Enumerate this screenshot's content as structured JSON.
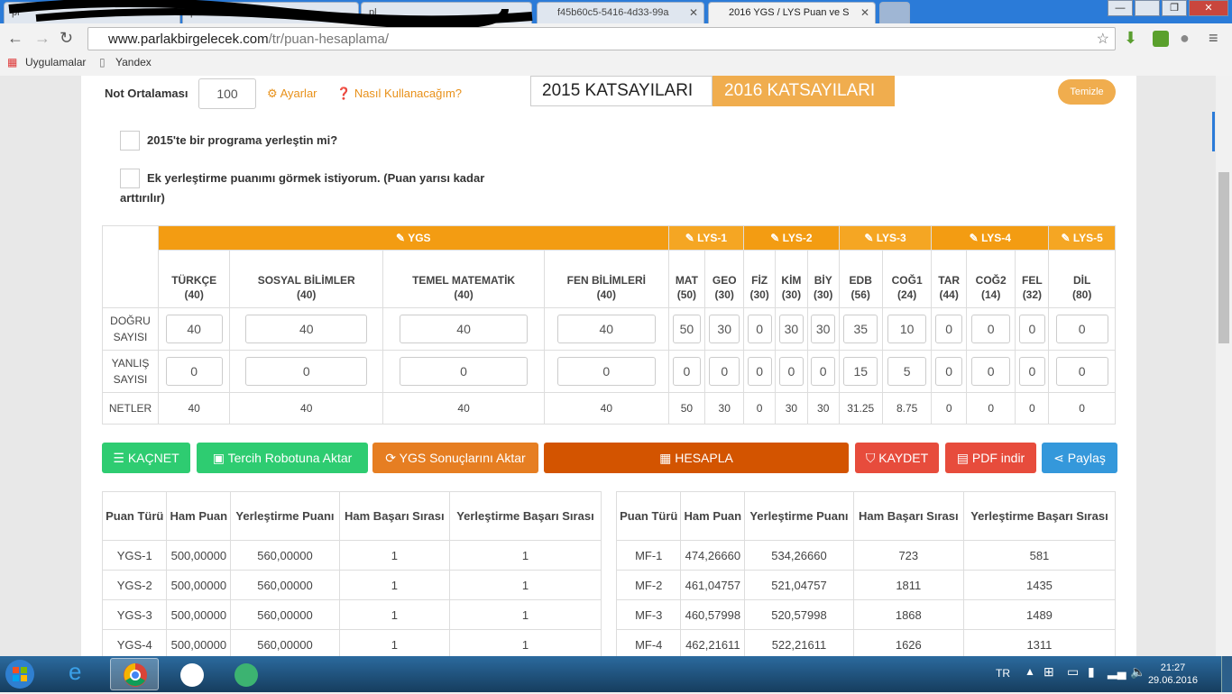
{
  "browser": {
    "tabs": [
      {
        "label": "pl"
      },
      {
        "label": "pl"
      },
      {
        "label": "f45b60c5-5416-4d33-99a"
      },
      {
        "label": "2016 YGS / LYS Puan ve S"
      }
    ],
    "url_domain": "www.parlakbirgelecek.com",
    "url_path": "/tr/puan-hesaplama/",
    "bookmarks": [
      "Uygulamalar",
      "Yandex"
    ]
  },
  "form": {
    "not_ortalamasi_label": "Not Ortalaması",
    "not_ortalamasi_value": "100",
    "ayarlar": "Ayarlar",
    "nasil": "Nasıl Kullanacağım?",
    "coef_2015": "2015 KATSAYILARI",
    "coef_2016": "2016 KATSAYILARI",
    "temizle": "Temizle",
    "check1": "2015'te bir programa yerleştin mi?",
    "check2_line1": "Ek yerleştirme puanımı görmek istiyorum. (Puan yarısı kadar",
    "check2_line2": "arttırılır)"
  },
  "score_table": {
    "groups": [
      "YGS",
      "LYS-1",
      "LYS-2",
      "LYS-3",
      "LYS-4",
      "LYS-5"
    ],
    "subjects": [
      [
        "TÜRKÇE",
        "(40)"
      ],
      [
        "SOSYAL BİLİMLER",
        "(40)"
      ],
      [
        "TEMEL MATEMATİK",
        "(40)"
      ],
      [
        "FEN BİLİMLERİ",
        "(40)"
      ],
      [
        "MAT",
        "(50)"
      ],
      [
        "GEO",
        "(30)"
      ],
      [
        "FİZ",
        "(30)"
      ],
      [
        "KİM",
        "(30)"
      ],
      [
        "BİY",
        "(30)"
      ],
      [
        "EDB",
        "(56)"
      ],
      [
        "COĞ1",
        "(24)"
      ],
      [
        "TAR",
        "(44)"
      ],
      [
        "COĞ2",
        "(14)"
      ],
      [
        "FEL",
        "(32)"
      ],
      [
        "DİL",
        "(80)"
      ]
    ],
    "row_labels": {
      "dogru": "DOĞRU SAYISI",
      "yanlis": "YANLIŞ SAYISI",
      "netler": "NETLER"
    },
    "dogru": [
      "40",
      "40",
      "40",
      "40",
      "50",
      "30",
      "0",
      "30",
      "30",
      "35",
      "10",
      "0",
      "0",
      "0",
      "0"
    ],
    "yanlis": [
      "0",
      "0",
      "0",
      "0",
      "0",
      "0",
      "0",
      "0",
      "0",
      "15",
      "5",
      "0",
      "0",
      "0",
      "0"
    ],
    "netler": [
      "40",
      "40",
      "40",
      "40",
      "50",
      "30",
      "0",
      "30",
      "30",
      "31.25",
      "8.75",
      "0",
      "0",
      "0",
      "0"
    ]
  },
  "buttons": {
    "kacnet": "KAÇNET",
    "tercih": "Tercih Robotuna Aktar",
    "ygs_aktar": "YGS Sonuçlarını Aktar",
    "hesapla": "HESAPLA",
    "kaydet": "KAYDET",
    "pdf": "PDF indir",
    "paylas": "Paylaş"
  },
  "results": {
    "headers": [
      "Puan Türü",
      "Ham Puan",
      "Yerleştirme Puanı",
      "Ham Başarı Sırası",
      "Yerleştirme Başarı Sırası"
    ],
    "left": [
      [
        "YGS-1",
        "500,00000",
        "560,00000",
        "1",
        "1"
      ],
      [
        "YGS-2",
        "500,00000",
        "560,00000",
        "1",
        "1"
      ],
      [
        "YGS-3",
        "500,00000",
        "560,00000",
        "1",
        "1"
      ],
      [
        "YGS-4",
        "500,00000",
        "560,00000",
        "1",
        "1"
      ]
    ],
    "right": [
      [
        "MF-1",
        "474,26660",
        "534,26660",
        "723",
        "581"
      ],
      [
        "MF-2",
        "461,04757",
        "521,04757",
        "1811",
        "1435"
      ],
      [
        "MF-3",
        "460,57998",
        "520,57998",
        "1868",
        "1489"
      ],
      [
        "MF-4",
        "462,21611",
        "522,21611",
        "1626",
        "1311"
      ]
    ]
  },
  "taskbar": {
    "lang": "TR",
    "time": "21:27",
    "date": "29.06.2016"
  }
}
